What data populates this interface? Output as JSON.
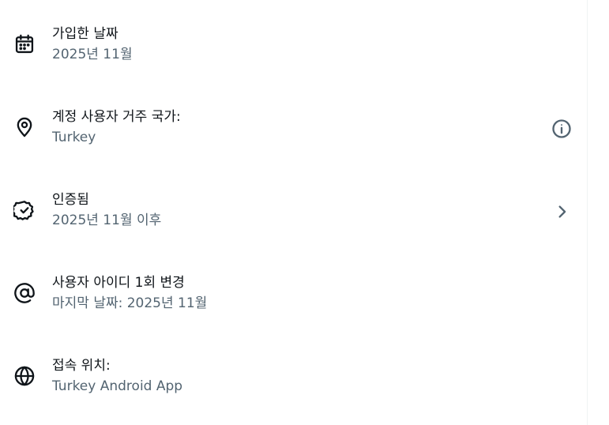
{
  "rows": [
    {
      "icon": "calendar-icon",
      "title": "가입한 날짜",
      "subtitle": "2025년 11월"
    },
    {
      "icon": "location-pin-icon",
      "title": "계정 사용자 거주 국가:",
      "subtitle": "Turkey",
      "trailing_icon": "info-icon"
    },
    {
      "icon": "verified-badge-icon",
      "title": "인증됨",
      "subtitle": "2025년 11월 이후",
      "trailing_icon": "chevron-right-icon"
    },
    {
      "icon": "at-sign-icon",
      "title": "사용자 아이디 1회 변경",
      "subtitle": "마지막 날짜: 2025년 11월"
    },
    {
      "icon": "globe-icon",
      "title": "접속 위치:",
      "subtitle": "Turkey Android App"
    }
  ],
  "colors": {
    "title_text": "#0f1419",
    "subtitle_text": "#536471",
    "divider": "#eff3f4"
  }
}
